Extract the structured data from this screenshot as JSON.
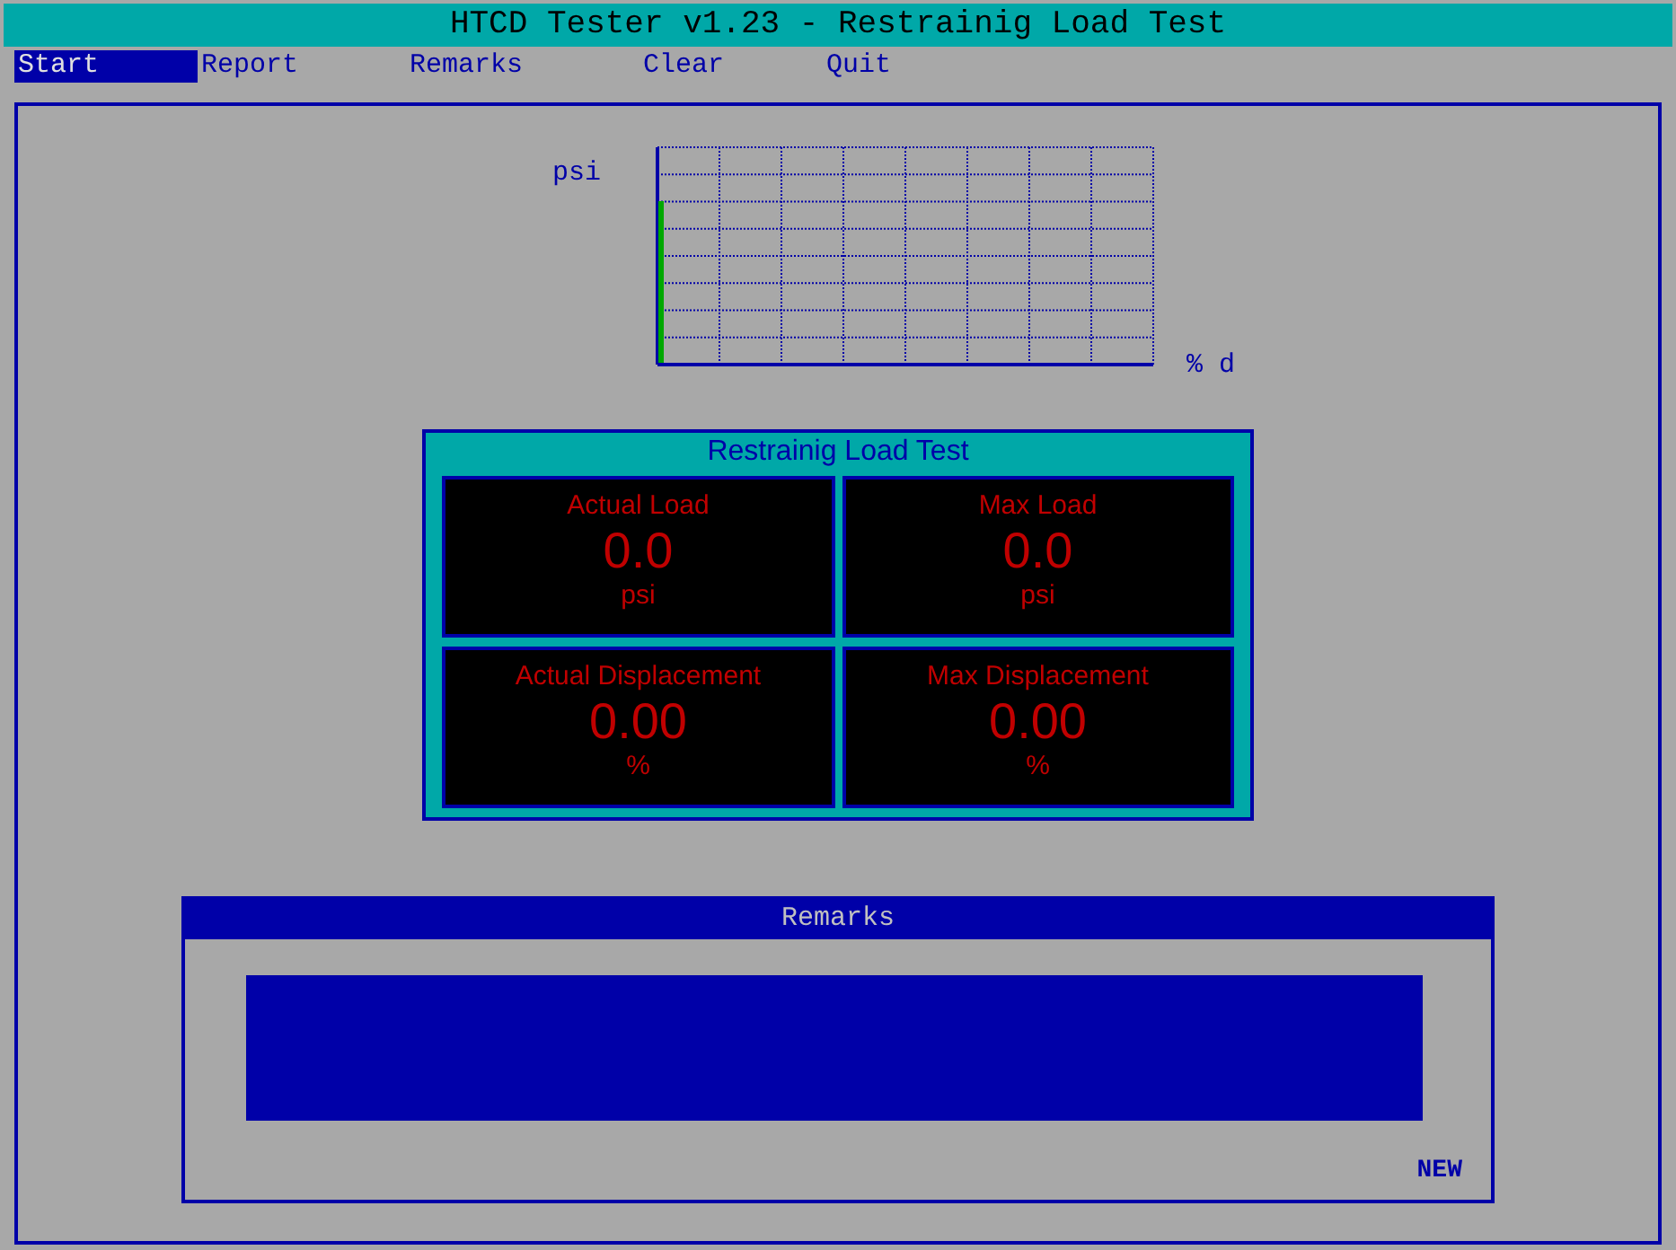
{
  "window": {
    "title": "HTCD Tester v1.23 - Restrainig Load Test"
  },
  "menu": [
    {
      "label": "Start",
      "selected": true
    },
    {
      "label": "Report",
      "selected": false
    },
    {
      "label": "Remarks",
      "selected": false
    },
    {
      "label": "Clear",
      "selected": false
    },
    {
      "label": "Quit",
      "selected": false
    }
  ],
  "graph": {
    "y_label": "psi",
    "x_label": "% d"
  },
  "readings_panel": {
    "title": "Restrainig Load Test",
    "readings": [
      {
        "label": "Actual Load",
        "value": "0.0",
        "unit": "psi"
      },
      {
        "label": "Max Load",
        "value": "0.0",
        "unit": "psi"
      },
      {
        "label": "Actual Displacement",
        "value": "0.00",
        "unit": "%"
      },
      {
        "label": "Max Displacement",
        "value": "0.00",
        "unit": "%"
      }
    ]
  },
  "remarks": {
    "title": "Remarks",
    "status": "NEW"
  }
}
